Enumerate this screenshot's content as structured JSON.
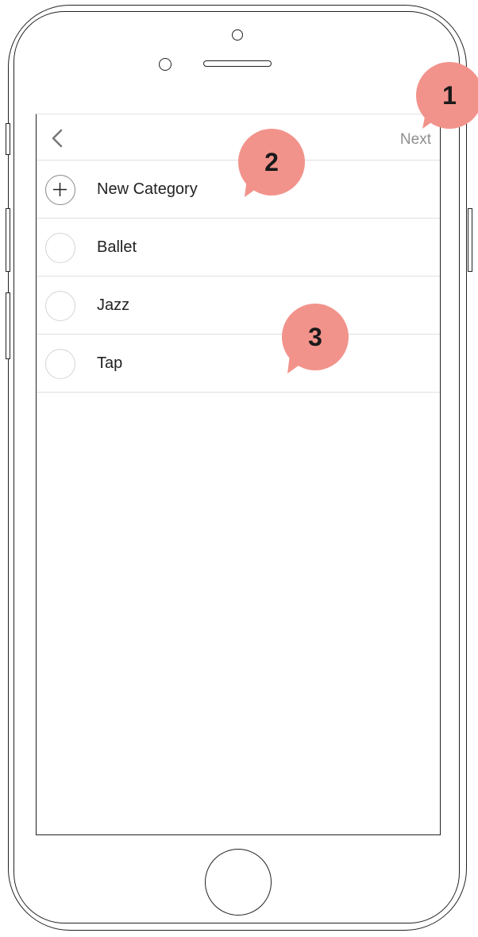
{
  "nav": {
    "back_icon": "chevron-left-icon",
    "next_label": "Next"
  },
  "list": {
    "items": [
      {
        "label": "New Category",
        "icon": "plus-icon"
      },
      {
        "label": "Ballet",
        "icon": "radio-empty-icon"
      },
      {
        "label": "Jazz",
        "icon": "radio-empty-icon"
      },
      {
        "label": "Tap",
        "icon": "radio-empty-icon"
      }
    ]
  },
  "annotations": [
    "1",
    "2",
    "3"
  ],
  "colors": {
    "annotation_fill": "#f2938b",
    "next_text": "#8f8f8f",
    "divider": "#e0e0e0"
  }
}
